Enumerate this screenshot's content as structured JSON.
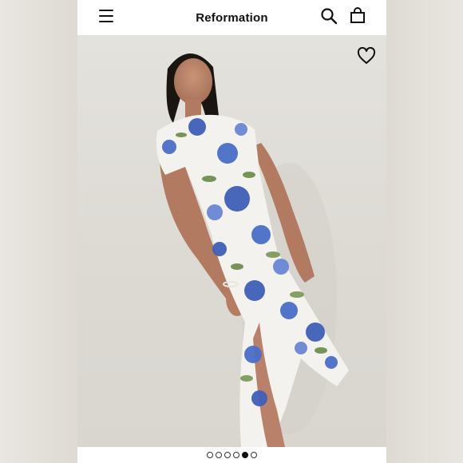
{
  "header": {
    "brand": "Reformation"
  },
  "icons": {
    "menu": "menu-icon",
    "search": "search-icon",
    "bag": "shopping-bag-icon",
    "favorite": "heart-icon"
  },
  "carousel": {
    "total": 6,
    "active_index": 4
  },
  "colors": {
    "brand_text": "#111111",
    "background": "#ffffff",
    "dress_blue": "#3f5fb8",
    "dress_green": "#6f8f4e"
  }
}
